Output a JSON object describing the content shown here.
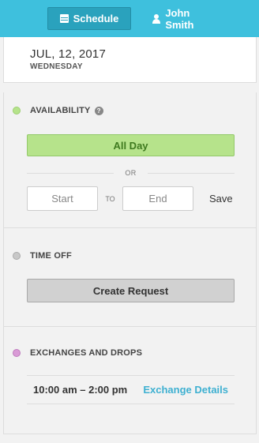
{
  "topbar": {
    "schedule_label": "Schedule",
    "user_label": "John Smith",
    "accent": "#3ec0dd"
  },
  "date": {
    "main": "JUL, 12, 2017",
    "weekday": "WEDNESDAY"
  },
  "availability": {
    "title": "AVAILABILITY",
    "dot_color": "#b6e38b",
    "all_day_label": "All Day",
    "or_label": "OR",
    "start_placeholder": "Start",
    "to_label": "TO",
    "end_placeholder": "End",
    "save_label": "Save"
  },
  "time_off": {
    "title": "TIME OFF",
    "dot_color": "#c8c8c8",
    "create_label": "Create Request"
  },
  "exchanges": {
    "title": "EXCHANGES AND DROPS",
    "dot_color": "#d99bd6",
    "items": [
      {
        "time": "10:00 am – 2:00 pm",
        "link": "Exchange Details"
      }
    ]
  }
}
